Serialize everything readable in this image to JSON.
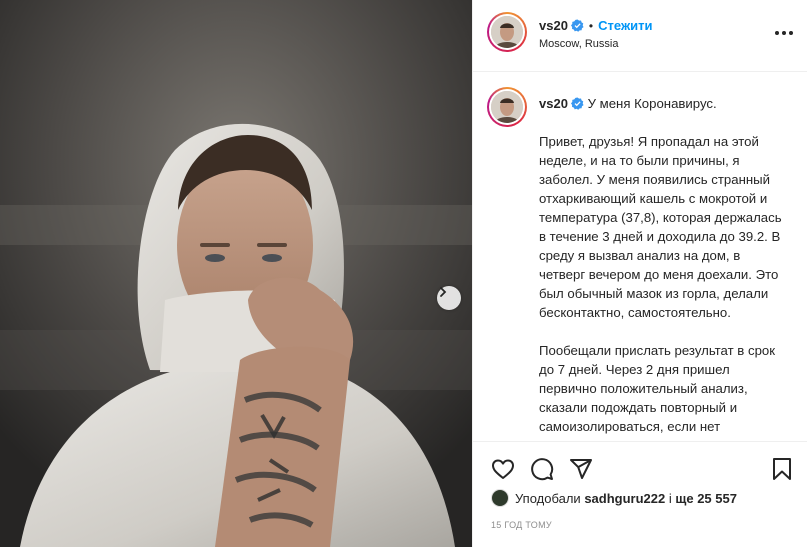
{
  "post": {
    "username": "vs20",
    "follow_label": "Стежити",
    "separator": "•",
    "location": "Moscow, Russia",
    "caption_title": "У меня Коронавирус.",
    "caption_body": "Привет, друзья! Я пропадал на этой неделе, и на то были причины, я заболел. У меня появились странный отхаркивающий кашель с мокротой и температура (37,8), которая держалась в течение 3 дней и доходила до 39.2. В среду я вызвал анализ на дом, в четверг вечером до меня доехали. Это был обычный мазок из горла, делали бесконтактно, самостоятельно.\n\nПообещали прислать результат в срок до 7 дней. Через 2 дня пришел первично положительный анализ, сказали подождать повторный и самоизолироваться, если нет",
    "likes_prefix": "Уподобали",
    "likes_user": "sadhguru222",
    "likes_middle": "і",
    "likes_count_label": "ще 25 557",
    "timestamp": "15 ГОД ТОМУ"
  },
  "icons": {
    "verified": "verified-badge-icon",
    "more": "more-options-icon",
    "next": "chevron-right-icon",
    "like": "heart-icon",
    "comment": "comment-icon",
    "share": "paper-plane-icon",
    "save": "bookmark-icon"
  },
  "colors": {
    "accent": "#0095f6",
    "text": "#262626",
    "muted": "#8e8e8e"
  }
}
